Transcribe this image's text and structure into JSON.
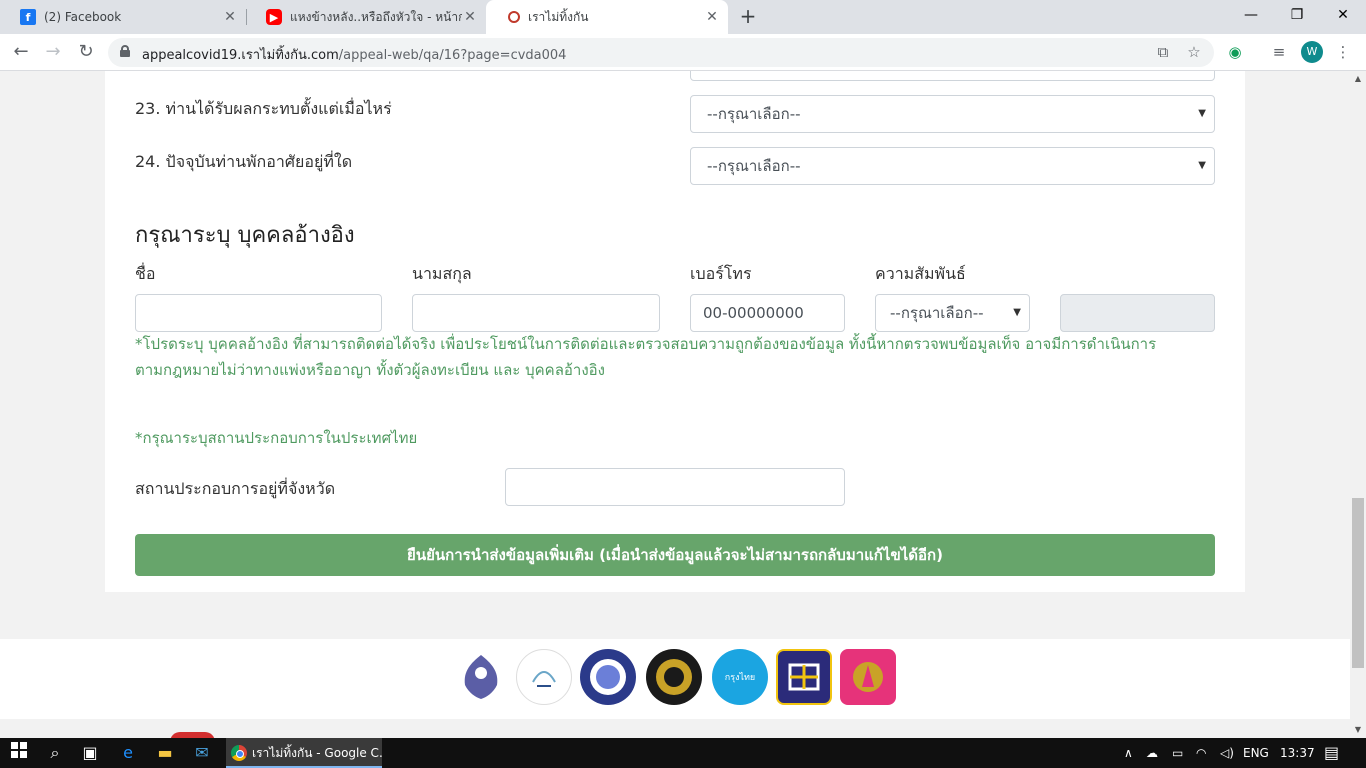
{
  "browser": {
    "tabs": [
      {
        "label": "(2) Facebook",
        "icon": "facebook-icon",
        "color": "#1877f2"
      },
      {
        "label": "แหงข้างหลัง..หรือถึงหัวใจ - หน้ากากลูกไก่",
        "icon": "youtube-icon",
        "color": "#ff0000"
      },
      {
        "label": "เราไม่ทิ้งกัน",
        "icon": "site-icon",
        "color": "#c0392b"
      }
    ],
    "new_tab": "+",
    "window": {
      "minimize": "—",
      "restore": "❐",
      "close": "✕"
    },
    "url_host": "appealcovid19.เราไม่ทิ้งกัน.com",
    "url_path": "/appeal-web/qa/16?page=cvda004",
    "profile_initial": "W"
  },
  "form": {
    "q23": {
      "label": "23. ท่านได้รับผลกระทบตั้งแต่เมื่อไหร่",
      "value": "--กรุณาเลือก--"
    },
    "q24": {
      "label": "24. ปัจจุบันท่านพักอาศัยอยู่ที่ใด",
      "value": "--กรุณาเลือก--"
    },
    "reference": {
      "title": "กรุณาระบุ บุคคลอ้างอิง",
      "first_name_label": "ชื่อ",
      "last_name_label": "นามสกุล",
      "phone_label": "เบอร์โทร",
      "phone_placeholder": "00-00000000",
      "relation_label": "ความสัมพันธ์",
      "relation_value": "--กรุณาเลือก--",
      "note_line1": "*โปรดระบุ บุคคลอ้างอิง ที่สามารถติดต่อได้จริง เพื่อประโยชน์ในการติดต่อและตรวจสอบความถูกต้องของข้อมูล ทั้งนี้หากตรวจพบข้อมูลเท็จ อาจมีการดำเนินการ",
      "note_line2": "ตามกฎหมายไม่ว่าทางแพ่งหรืออาญา ทั้งตัวผู้ลงทะเบียน และ บุคคลอ้างอิง"
    },
    "business": {
      "note": "*กรุณาระบุสถานประกอบการในประเทศไทย",
      "province_label": "สถานประกอบการอยู่ที่จังหวัด"
    },
    "submit_label": "ยืนยันการนำส่งข้อมูลเพิ่มเติม (เมื่อนำส่งข้อมูลแล้วจะไม่สามารถกลับมาแก้ไขได้อีก)"
  },
  "footer": {
    "logos": [
      {
        "name": "comptroller-logo",
        "text": "กรมบัญชีกลาง",
        "color": "#5b5ea6"
      },
      {
        "name": "fiscal-office-logo",
        "text": "",
        "color": "#e8eef5"
      },
      {
        "name": "ministry-of-finance-logo",
        "text": "",
        "color": "#2b3a8a"
      },
      {
        "name": "revenue-dept-logo",
        "text": "",
        "color": "#1a1a1a"
      },
      {
        "name": "krungthai-logo",
        "text": "กรุงไทย",
        "color": "#1ba5e1"
      },
      {
        "name": "baac-logo",
        "text": "",
        "color": "#2b2b7a"
      },
      {
        "name": "gsb-logo",
        "text": "",
        "color": "#e6337a"
      }
    ]
  },
  "taskbar": {
    "app_label": "เราไม่ทิ้งกัน - Google C...",
    "language": "ENG",
    "time": "13:37"
  }
}
